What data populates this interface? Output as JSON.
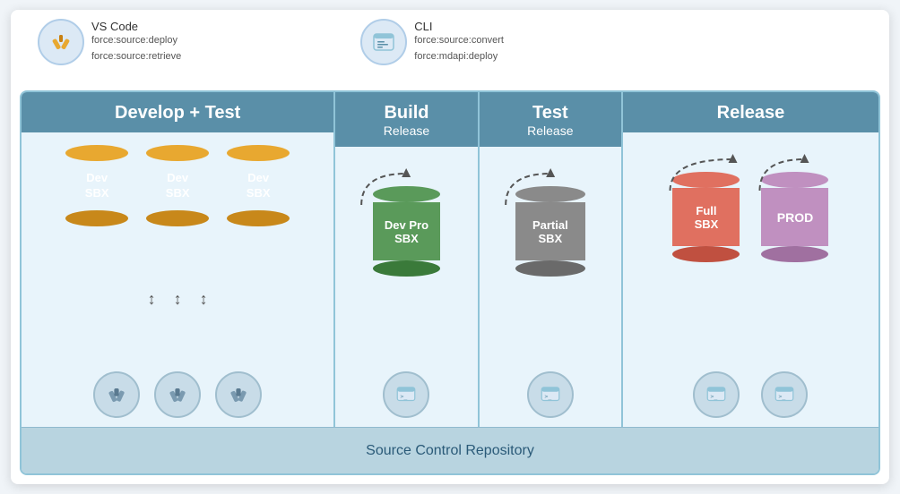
{
  "top": {
    "left_label": "VS Code",
    "left_cmd1": "force:source:deploy",
    "left_cmd2": "force:source:retrieve",
    "right_label": "CLI",
    "right_cmd1": "force:source:convert",
    "right_cmd2": "force:mdapi:deploy"
  },
  "phases": [
    {
      "id": "develop",
      "title_main": "Develop + Test",
      "title_sub": "",
      "cylinders": [
        {
          "label": "Dev\nSBX",
          "color": "orange"
        },
        {
          "label": "Dev\nSBX",
          "color": "orange"
        },
        {
          "label": "Dev\nSBX",
          "color": "orange"
        }
      ],
      "tools": [
        "wrench",
        "wrench",
        "wrench"
      ]
    },
    {
      "id": "build",
      "title_main": "Build",
      "title_sub": "Release",
      "cylinders": [
        {
          "label": "Dev Pro\nSBX",
          "color": "green"
        }
      ],
      "tools": [
        "terminal"
      ]
    },
    {
      "id": "test",
      "title_main": "Test",
      "title_sub": "Release",
      "cylinders": [
        {
          "label": "Partial\nSBX",
          "color": "gray"
        }
      ],
      "tools": [
        "terminal"
      ]
    },
    {
      "id": "release",
      "title_main": "Release",
      "title_sub": "",
      "cylinders": [
        {
          "label": "Full\nSBX",
          "color": "salmon"
        },
        {
          "label": "PROD",
          "color": "purple"
        }
      ],
      "tools": [
        "terminal",
        "terminal"
      ]
    }
  ],
  "source_control_label": "Source Control Repository"
}
